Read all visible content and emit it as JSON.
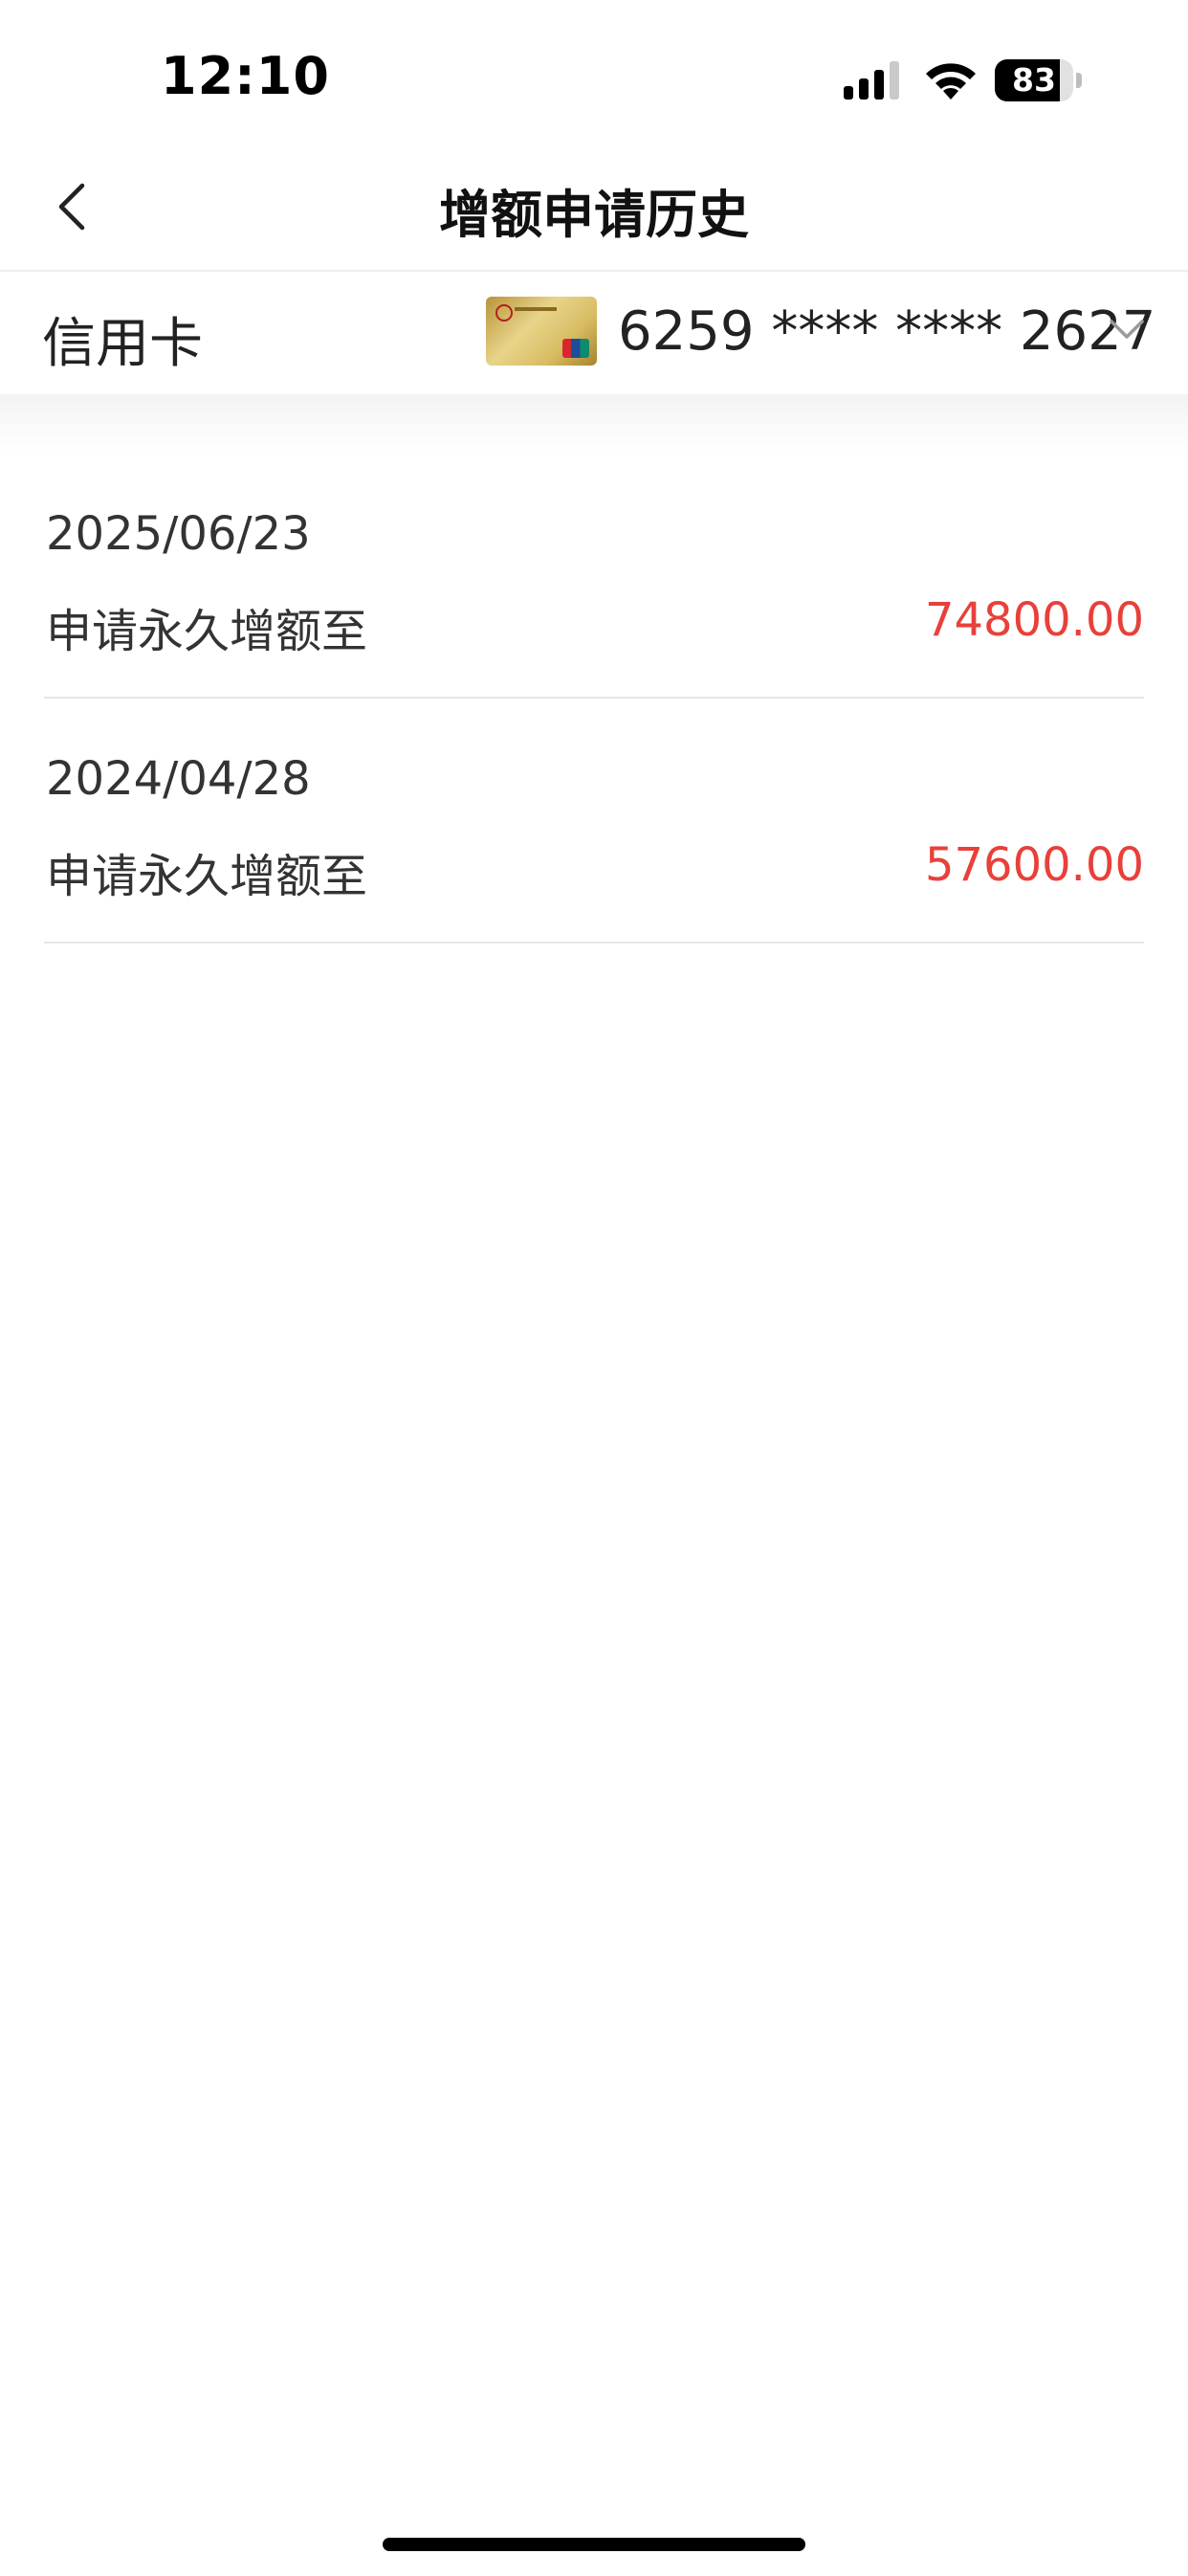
{
  "status_bar": {
    "time": "12:10",
    "battery_level": "83",
    "battery_fraction": 0.83
  },
  "nav": {
    "title": "增额申请历史"
  },
  "card_selector": {
    "label": "信用卡",
    "card_number": "6259 **** **** 2627",
    "card_image_icon": "gold-credit-card-icon",
    "dropdown_icon": "chevron-down-icon"
  },
  "history": [
    {
      "date": "2025/06/23",
      "description": "申请永久增额至",
      "amount": "74800.00"
    },
    {
      "date": "2024/04/28",
      "description": "申请永久增额至",
      "amount": "57600.00"
    }
  ],
  "colors": {
    "amount": "#e8403a",
    "background": "#ffffff",
    "divider": "#e6e6e6"
  }
}
